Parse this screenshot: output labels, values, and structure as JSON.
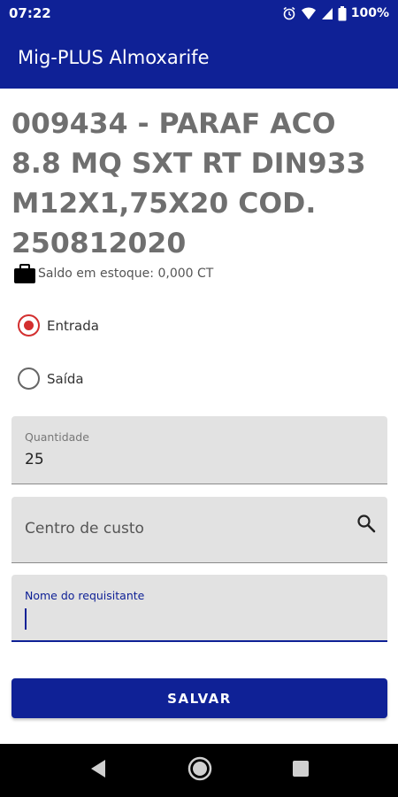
{
  "status_bar": {
    "time": "07:22",
    "battery": "100%",
    "icons": [
      "alarm-icon",
      "wifi-icon",
      "signal-icon",
      "battery-icon"
    ]
  },
  "app_bar": {
    "title": "Mig-PLUS Almoxarife"
  },
  "product": {
    "title": "009434 - PARAF ACO 8.8 MQ SXT RT DIN933 M12X1,75X20 COD. 250812020",
    "stock_text": "Saldo em estoque: 0,000 CT"
  },
  "movement": {
    "options": [
      {
        "label": "Entrada",
        "selected": true
      },
      {
        "label": "Saída",
        "selected": false
      }
    ]
  },
  "form": {
    "quantity_label": "Quantidade",
    "quantity_value": "25",
    "cost_center_placeholder": "Centro de custo",
    "requester_label": "Nome do requisitante",
    "requester_value": ""
  },
  "actions": {
    "save_label": "SALVAR"
  },
  "colors": {
    "primary": "#0f2196",
    "radio_selected": "#d32f2f",
    "field_bg": "#e2e2e2"
  }
}
